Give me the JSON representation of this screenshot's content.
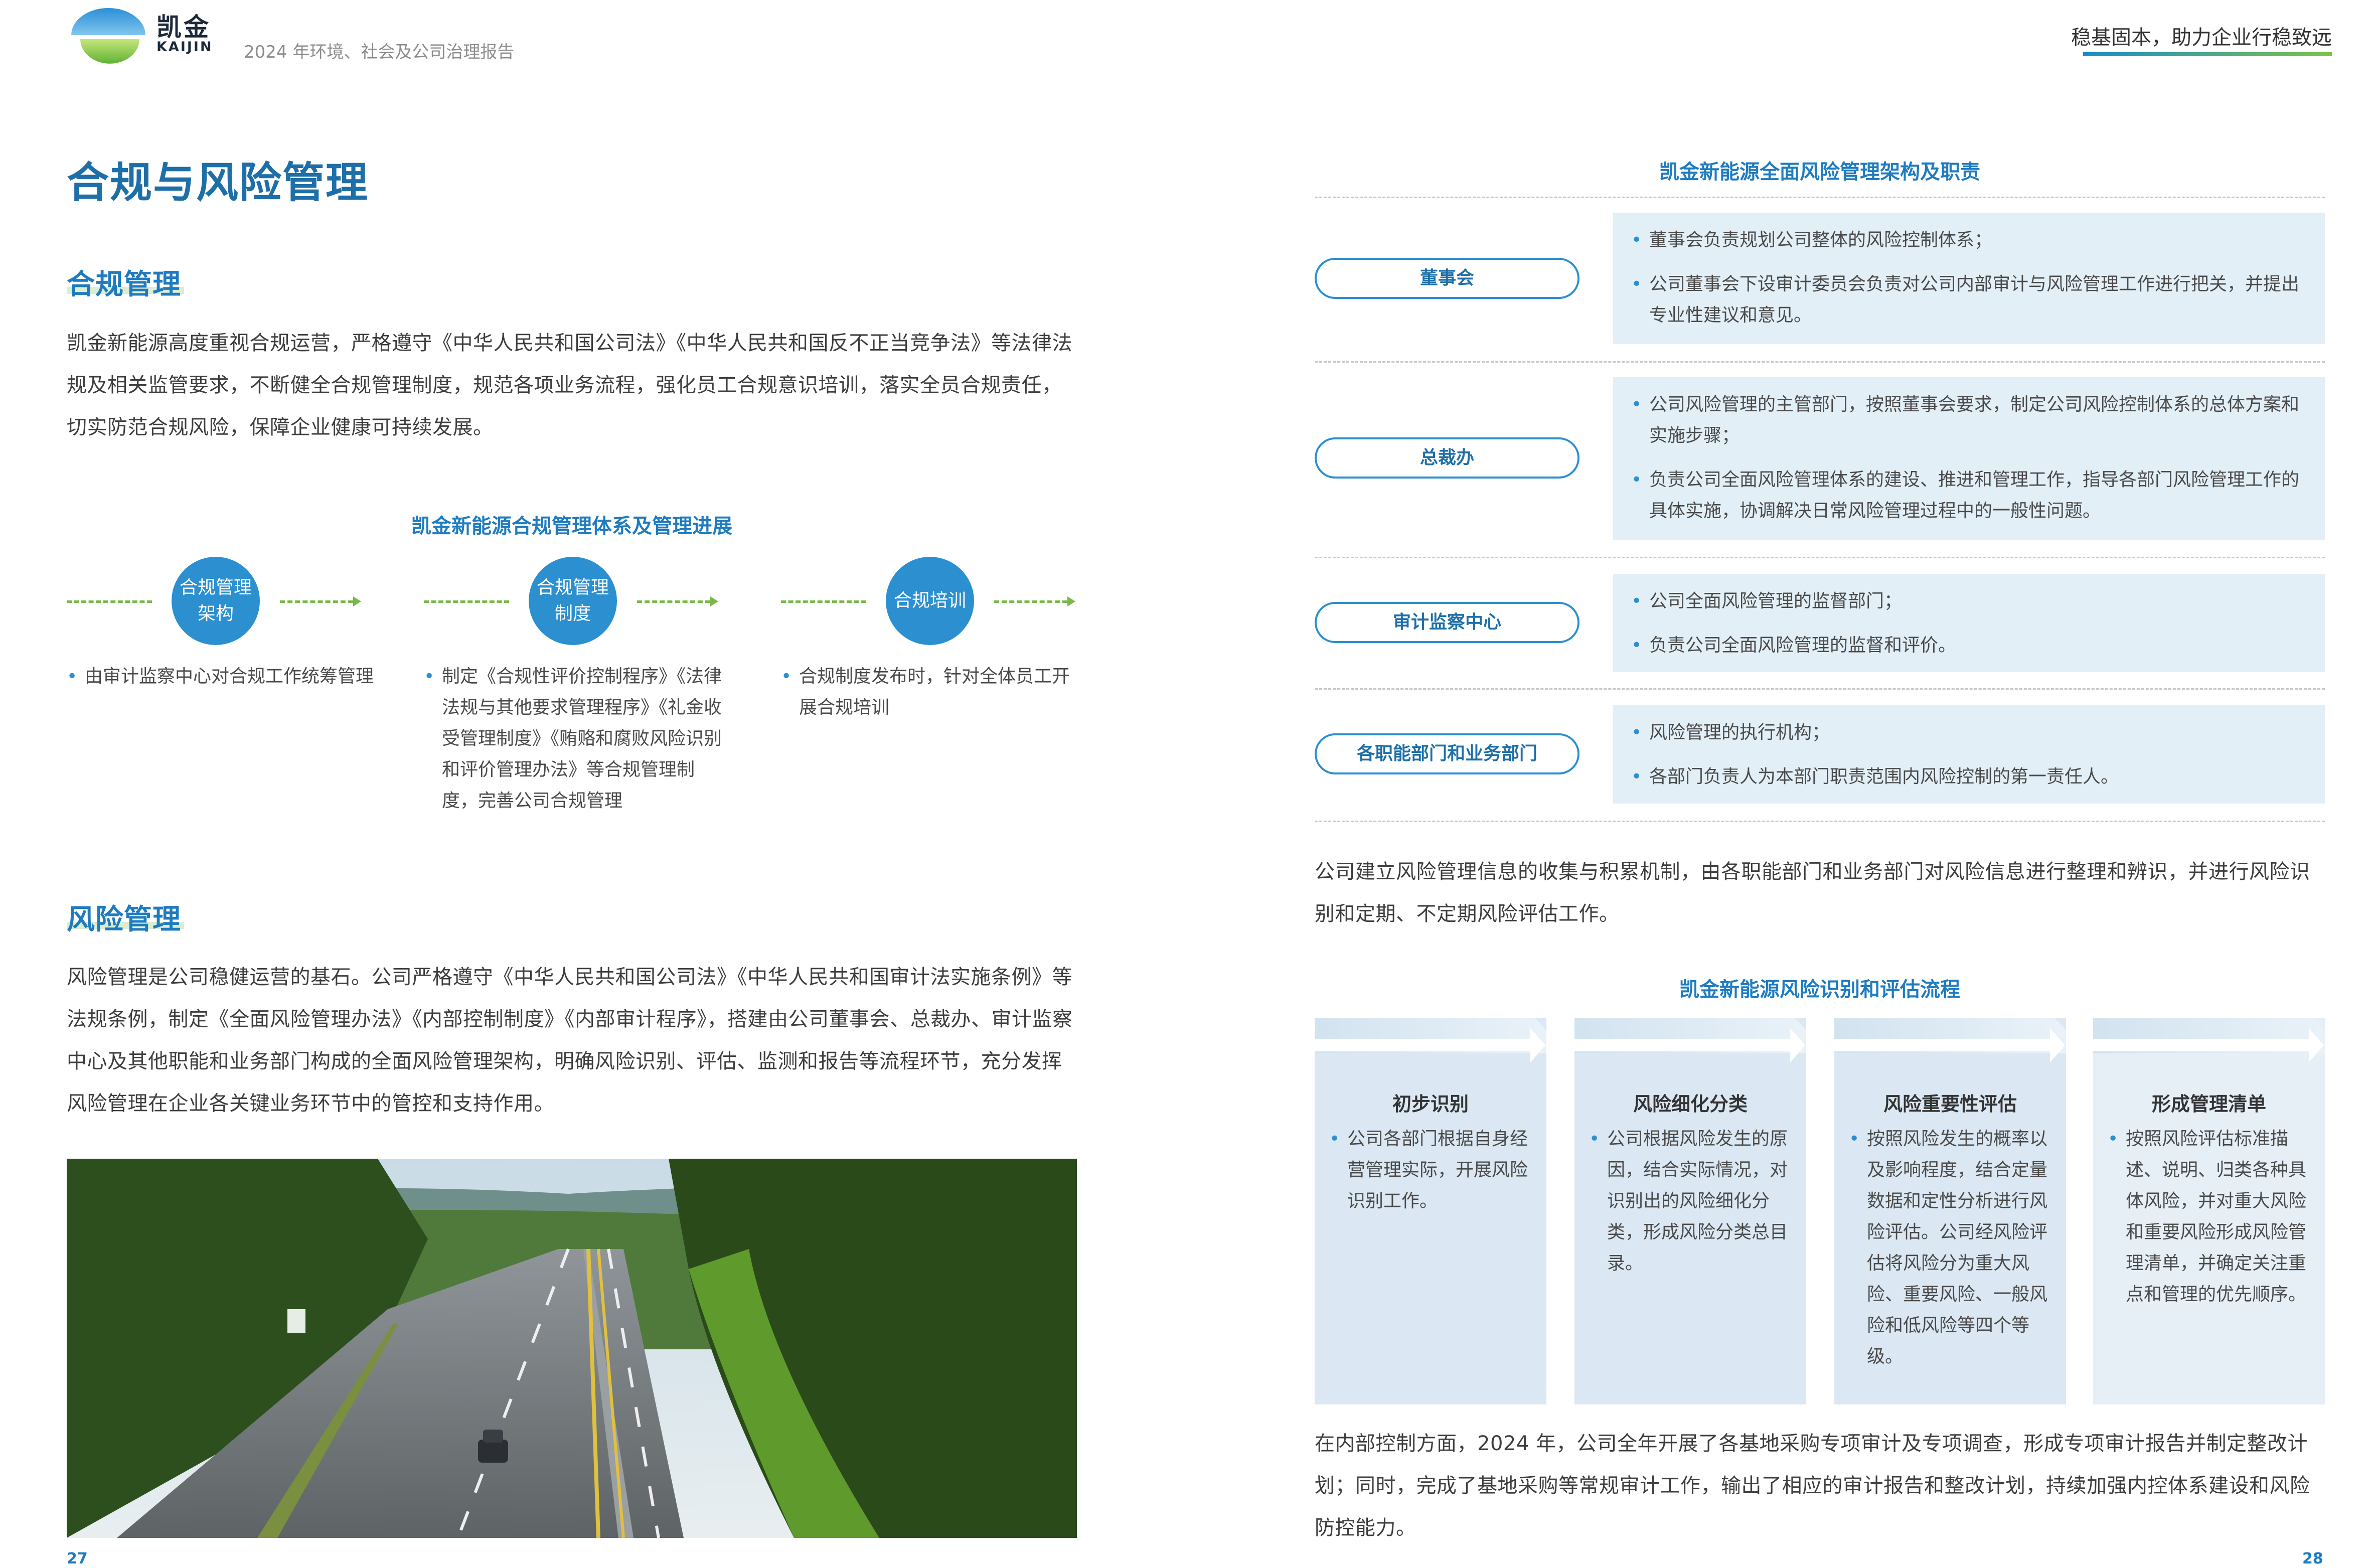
{
  "header": {
    "logo_cn": "凯金",
    "logo_en": "KAIJIN",
    "report_title": "2024 年环境、社会及公司治理报告",
    "slogan": "稳基固本，助力企业行稳致远"
  },
  "left": {
    "title": "合规与风险管理",
    "compliance": {
      "heading": "合规管理",
      "paragraph": "凯金新能源高度重视合规运营，严格遵守《中华人民共和国公司法》《中华人民共和国反不正当竞争法》等法律法规及相关监管要求，不断健全合规管理制度，规范各项业务流程，强化员工合规意识培训，落实全员合规责任，切实防范合规风险，保障企业健康可持续发展。",
      "diagram_title": "凯金新能源合规管理体系及管理进展",
      "steps": [
        {
          "label": "合规管理架构",
          "items": [
            "由审计监察中心对合规工作统筹管理"
          ]
        },
        {
          "label": "合规管理制度",
          "items": [
            "制定《合规性评价控制程序》《法律法规与其他要求管理程序》《礼金收受管理制度》《贿赂和腐败风险识别和评价管理办法》等合规管理制度，完善公司合规管理"
          ]
        },
        {
          "label": "合规培训",
          "items": [
            "合规制度发布时，针对全体员工开展合规培训"
          ]
        }
      ]
    },
    "risk": {
      "heading": "风险管理",
      "paragraph": "风险管理是公司稳健运营的基石。公司严格遵守《中华人民共和国公司法》《中华人民共和国审计法实施条例》等法规条例，制定《全面风险管理办法》《内部控制制度》《内部审计程序》，搭建由公司董事会、总裁办、审计监察中心及其他职能和业务部门构成的全面风险管理架构，明确风险识别、评估、监测和报告等流程环节，充分发挥风险管理在企业各关键业务环节中的管控和支持作用。"
    },
    "page_number": "27"
  },
  "right": {
    "org_title": "凯金新能源全面风险管理架构及职责",
    "org": [
      {
        "name": "董事会",
        "items": [
          "董事会负责规划公司整体的风险控制体系；",
          "公司董事会下设审计委员会负责对公司内部审计与风险管理工作进行把关，并提出专业性建议和意见。"
        ]
      },
      {
        "name": "总裁办",
        "items": [
          "公司风险管理的主管部门，按照董事会要求，制定公司风险控制体系的总体方案和实施步骤；",
          "负责公司全面风险管理体系的建设、推进和管理工作，指导各部门风险管理工作的具体实施，协调解决日常风险管理过程中的一般性问题。"
        ]
      },
      {
        "name": "审计监察中心",
        "items": [
          "公司全面风险管理的监督部门；",
          "负责公司全面风险管理的监督和评价。"
        ]
      },
      {
        "name": "各职能部门和业务部门",
        "items": [
          "风险管理的执行机构；",
          "各部门负责人为本部门职责范围内风险控制的第一责任人。"
        ]
      }
    ],
    "info_paragraph": "公司建立风险管理信息的收集与积累机制，由各职能部门和业务部门对风险信息进行整理和辨识，并进行风险识别和定期、不定期风险评估工作。",
    "flow_title": "凯金新能源风险识别和评估流程",
    "flow": [
      {
        "title": "初步识别",
        "text": "公司各部门根据自身经营管理实际，开展风险识别工作。"
      },
      {
        "title": "风险细化分类",
        "text": "公司根据风险发生的原因，结合实际情况，对识别出的风险细化分类，形成风险分类总目录。"
      },
      {
        "title": "风险重要性评估",
        "text": "按照风险发生的概率以及影响程度，结合定量数据和定性分析进行风险评估。公司经风险评估将风险分为重大风险、重要风险、一般风险和低风险等四个等级。"
      },
      {
        "title": "形成管理清单",
        "text": "按照风险评估标准描述、说明、归类各种具体风险，并对重大风险和重要风险形成风险管理清单，并确定关注重点和管理的优先顺序。"
      }
    ],
    "audit_paragraph": "在内部控制方面，2024 年，公司全年开展了各基地采购专项审计及专项调查，形成专项审计报告并制定整改计划；同时，完成了基地采购等常规审计工作，输出了相应的审计报告和整改计划，持续加强内控体系建设和风险防控能力。",
    "page_number": "28"
  },
  "colors": {
    "primary_blue": "#1e7bc0",
    "circle_blue": "#2b8fd0",
    "green": "#7ab84a",
    "box_bg": "#e3eff7"
  }
}
